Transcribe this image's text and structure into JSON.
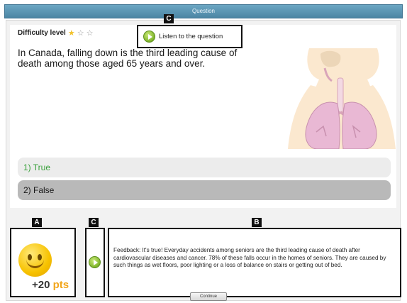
{
  "window": {
    "title": "Question"
  },
  "question": {
    "difficulty_label": "Difficulty level",
    "difficulty_stars": {
      "filled": 1,
      "total": 3
    },
    "listen_label": "Listen to the question",
    "text": "In Canada, falling down is the third leading cause of death among those aged 65 years and over."
  },
  "illustration": {
    "icon": "respiratory-system-illustration"
  },
  "answers": [
    {
      "label": "1) True",
      "state": "correct"
    },
    {
      "label": "2) False",
      "state": "selected"
    }
  ],
  "markers": {
    "a": "A",
    "b": "B",
    "c": "C"
  },
  "score": {
    "points_num": "+20",
    "points_unit": "pts"
  },
  "feedback": {
    "text": "Feedback: It's true! Everyday accidents among seniors are the third leading cause of death after cardiovascular diseases and cancer. 78% of these falls occur in the homes of seniors. They are caused by such things as wet floors, poor lighting or a loss of balance on stairs or getting out of bed."
  },
  "continue_label": "Continue",
  "colors": {
    "titlebar": "#4c86a4",
    "correct_text": "#3aa13c",
    "points_unit": "#f2a51a",
    "play_green": "#7fb52b"
  }
}
